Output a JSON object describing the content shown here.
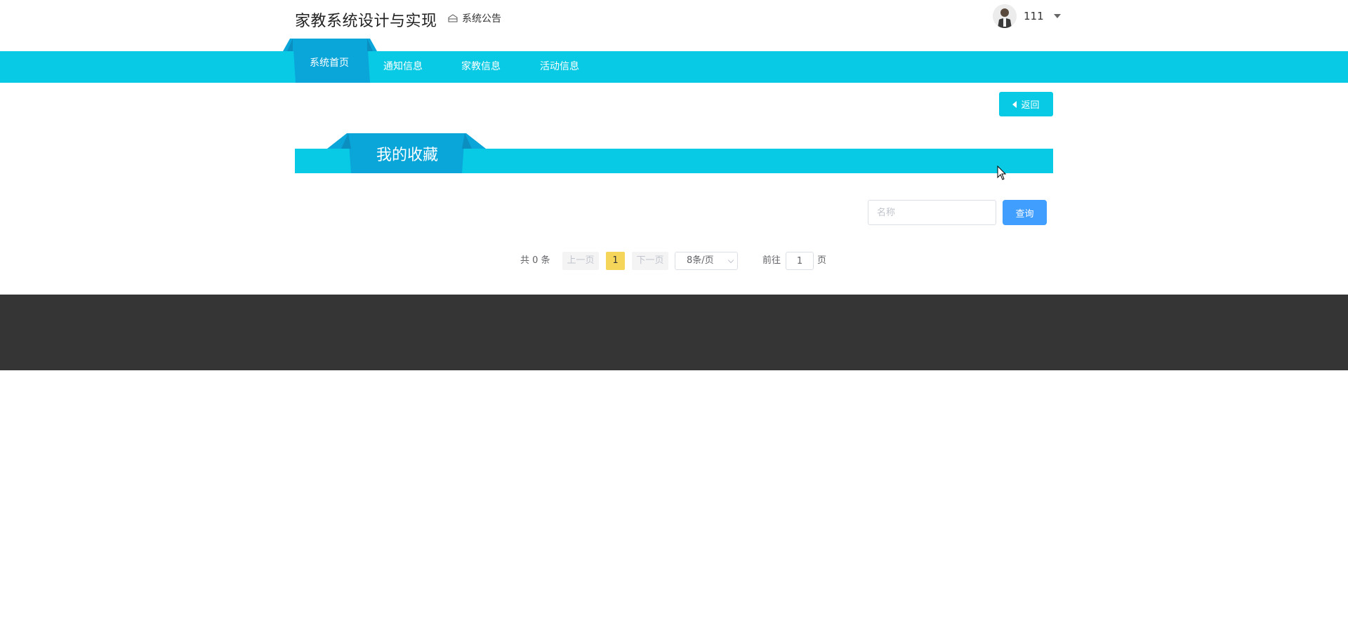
{
  "header": {
    "site_title": "家教系统设计与实现",
    "notice_label": "系统公告",
    "user": {
      "name": "111"
    }
  },
  "nav": {
    "items": [
      {
        "label": "系统首页",
        "active": true
      },
      {
        "label": "通知信息"
      },
      {
        "label": "家教信息"
      },
      {
        "label": "活动信息"
      }
    ]
  },
  "actions": {
    "back_label": "返回"
  },
  "section": {
    "title": "我的收藏"
  },
  "search": {
    "placeholder": "名称",
    "value": "",
    "button_label": "查询"
  },
  "pagination": {
    "total_text": "共 0 条",
    "prev_label": "上一页",
    "current_page": "1",
    "next_label": "下一页",
    "page_size_label": "8条/页",
    "goto_label": "前往",
    "goto_value": "1",
    "goto_suffix": "页"
  },
  "colors": {
    "primary": "#08cae4",
    "primary_dark": "#0aa5d9",
    "search_button": "#409eff",
    "active_page": "#f5d65a",
    "footer": "#353535"
  }
}
